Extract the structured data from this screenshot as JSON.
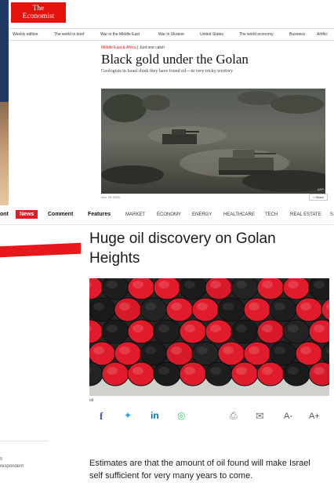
{
  "economist": {
    "logo_line1": "The",
    "logo_line2": "Economist",
    "nav": [
      "Weekly edition",
      "The world in brief",
      "War in the Middle East",
      "War in Ukraine",
      "United States",
      "The world economy",
      "Business",
      "Artifici"
    ],
    "kicker_section": "Middle East & Africa",
    "kicker_rest": " | Just one catch",
    "headline": "Black gold under the Golan",
    "subheadline": "Geologists in Israel think they have found oil—in very tricky territory",
    "date": "Nov 7th 2015",
    "share": "< Share",
    "photo_credit": "AFP"
  },
  "site": {
    "nav": {
      "prev_fragment": "ont",
      "news": "News",
      "comment": "Comment",
      "features": "Features",
      "market": "MARKET",
      "economy": "ECONOMY",
      "energy": "ENERGY",
      "healthcare": "HEALTHCARE",
      "tech": "TECH",
      "real_estate": "REAL ESTATE",
      "more_fragment": "S"
    },
    "article": {
      "title": "Huge oil discovery on Golan Heights",
      "caption": "oil",
      "share_facebook": "f",
      "share_twitter": "✦",
      "share_linkedin": "in",
      "share_whatsapp": "◎",
      "print_icon": "⎙",
      "mail_icon": "✉",
      "font_smaller": "A-",
      "font_larger": "A+",
      "body": "Estimates are that the amount of oil found will make Israel self sufficient for very many years to come."
    },
    "sidebar": {
      "date_fragment": "9",
      "byline_fragment": "respondent"
    }
  }
}
